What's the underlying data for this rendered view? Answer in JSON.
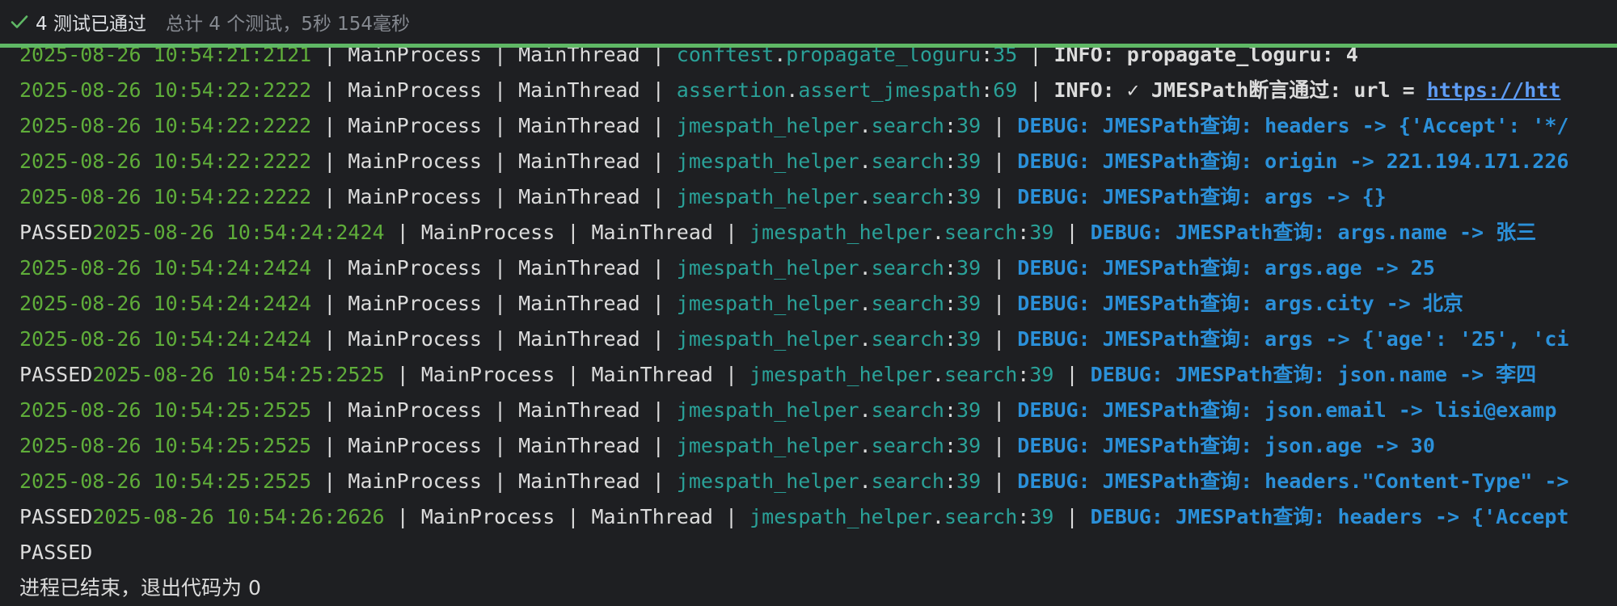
{
  "status": {
    "title": "4 测试已通过",
    "summary": "总计 4 个测试，5秒 154毫秒"
  },
  "console": {
    "lines": [
      {
        "prefix": "",
        "timestamp": "2025-08-26 10:54:21:2121",
        "process": "MainProcess",
        "thread": "MainThread",
        "module": "conftest",
        "function": "propagate_loguru",
        "lineno": "35",
        "level": "INFO",
        "message": "propagate_loguru: 4",
        "link": ""
      },
      {
        "prefix": "",
        "timestamp": "2025-08-26 10:54:22:2222",
        "process": "MainProcess",
        "thread": "MainThread",
        "module": "assertion",
        "function": "assert_jmespath",
        "lineno": "69",
        "level": "INFO",
        "message": "✓ JMESPath断言通过: url = ",
        "link": "https://htt"
      },
      {
        "prefix": "",
        "timestamp": "2025-08-26 10:54:22:2222",
        "process": "MainProcess",
        "thread": "MainThread",
        "module": "jmespath_helper",
        "function": "search",
        "lineno": "39",
        "level": "DEBUG",
        "message": "JMESPath查询: headers -> {'Accept': '*/",
        "link": ""
      },
      {
        "prefix": "",
        "timestamp": "2025-08-26 10:54:22:2222",
        "process": "MainProcess",
        "thread": "MainThread",
        "module": "jmespath_helper",
        "function": "search",
        "lineno": "39",
        "level": "DEBUG",
        "message": "JMESPath查询: origin -> 221.194.171.226",
        "link": ""
      },
      {
        "prefix": "",
        "timestamp": "2025-08-26 10:54:22:2222",
        "process": "MainProcess",
        "thread": "MainThread",
        "module": "jmespath_helper",
        "function": "search",
        "lineno": "39",
        "level": "DEBUG",
        "message": "JMESPath查询: args -> {}",
        "link": ""
      },
      {
        "prefix": "PASSED",
        "timestamp": "2025-08-26 10:54:24:2424",
        "process": "MainProcess",
        "thread": "MainThread",
        "module": "jmespath_helper",
        "function": "search",
        "lineno": "39",
        "level": "DEBUG",
        "message": "JMESPath查询: args.name -> 张三",
        "link": ""
      },
      {
        "prefix": "",
        "timestamp": "2025-08-26 10:54:24:2424",
        "process": "MainProcess",
        "thread": "MainThread",
        "module": "jmespath_helper",
        "function": "search",
        "lineno": "39",
        "level": "DEBUG",
        "message": "JMESPath查询: args.age -> 25",
        "link": ""
      },
      {
        "prefix": "",
        "timestamp": "2025-08-26 10:54:24:2424",
        "process": "MainProcess",
        "thread": "MainThread",
        "module": "jmespath_helper",
        "function": "search",
        "lineno": "39",
        "level": "DEBUG",
        "message": "JMESPath查询: args.city -> 北京",
        "link": ""
      },
      {
        "prefix": "",
        "timestamp": "2025-08-26 10:54:24:2424",
        "process": "MainProcess",
        "thread": "MainThread",
        "module": "jmespath_helper",
        "function": "search",
        "lineno": "39",
        "level": "DEBUG",
        "message": "JMESPath查询: args -> {'age': '25', 'ci",
        "link": ""
      },
      {
        "prefix": "PASSED",
        "timestamp": "2025-08-26 10:54:25:2525",
        "process": "MainProcess",
        "thread": "MainThread",
        "module": "jmespath_helper",
        "function": "search",
        "lineno": "39",
        "level": "DEBUG",
        "message": "JMESPath查询: json.name -> 李四",
        "link": ""
      },
      {
        "prefix": "",
        "timestamp": "2025-08-26 10:54:25:2525",
        "process": "MainProcess",
        "thread": "MainThread",
        "module": "jmespath_helper",
        "function": "search",
        "lineno": "39",
        "level": "DEBUG",
        "message": "JMESPath查询: json.email -> lisi@examp",
        "link": ""
      },
      {
        "prefix": "",
        "timestamp": "2025-08-26 10:54:25:2525",
        "process": "MainProcess",
        "thread": "MainThread",
        "module": "jmespath_helper",
        "function": "search",
        "lineno": "39",
        "level": "DEBUG",
        "message": "JMESPath查询: json.age -> 30",
        "link": ""
      },
      {
        "prefix": "",
        "timestamp": "2025-08-26 10:54:25:2525",
        "process": "MainProcess",
        "thread": "MainThread",
        "module": "jmespath_helper",
        "function": "search",
        "lineno": "39",
        "level": "DEBUG",
        "message": "JMESPath查询: headers.\"Content-Type\" ->",
        "link": ""
      },
      {
        "prefix": "PASSED",
        "timestamp": "2025-08-26 10:54:26:2626",
        "process": "MainProcess",
        "thread": "MainThread",
        "module": "jmespath_helper",
        "function": "search",
        "lineno": "39",
        "level": "DEBUG",
        "message": "JMESPath查询: headers -> {'Accept",
        "link": ""
      }
    ],
    "final_passed": "PASSED",
    "exit_message": "进程已结束，退出代码为 0"
  }
}
